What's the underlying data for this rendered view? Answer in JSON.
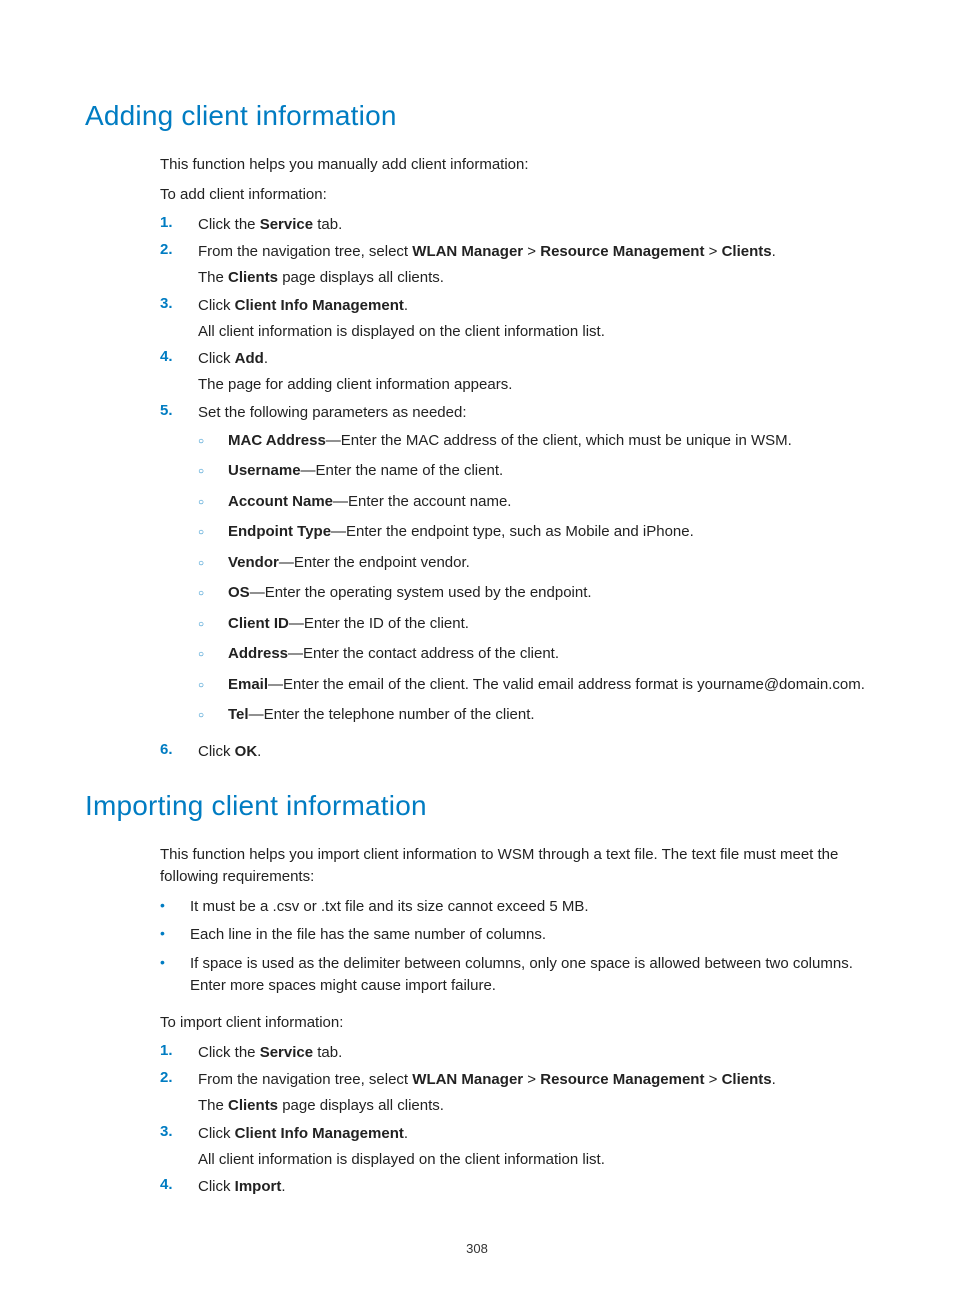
{
  "page_number": "308",
  "section_a": {
    "heading": "Adding client information",
    "intro1": "This function helps you manually add client information:",
    "intro2": "To add client information:",
    "steps": [
      {
        "num": "1.",
        "lines": [
          "Click the <b>Service</b> tab."
        ]
      },
      {
        "num": "2.",
        "lines": [
          "From the navigation tree, select <b>WLAN Manager</b> > <b>Resource Management</b> > <b>Clients</b>.",
          "The <b>Clients</b> page displays all clients."
        ]
      },
      {
        "num": "3.",
        "lines": [
          "Click <b>Client Info Management</b>.",
          "All client information is displayed on the client information list."
        ]
      },
      {
        "num": "4.",
        "lines": [
          "Click <b>Add</b>.",
          "The page for adding client information appears."
        ]
      },
      {
        "num": "5.",
        "lines": [
          "Set the following parameters as needed:"
        ],
        "sub": [
          "<b>MAC Address</b>—Enter the MAC address of the client, which must be unique in WSM.",
          "<b>Username</b>—Enter the name of the client.",
          "<b>Account Name</b>—Enter the account name.",
          "<b>Endpoint Type</b>—Enter the endpoint type, such as Mobile and iPhone.",
          "<b>Vendor</b>—Enter the endpoint vendor.",
          "<b>OS</b>—Enter the operating system used by the endpoint.",
          "<b>Client ID</b>—Enter the ID of the client.",
          "<b>Address</b>—Enter the contact address of the client.",
          "<b>Email</b>—Enter the email of the client. The valid email address format is yourname@domain.com.",
          "<b>Tel</b>—Enter the telephone number of the client."
        ]
      },
      {
        "num": "6.",
        "lines": [
          "Click <b>OK</b>."
        ]
      }
    ]
  },
  "section_b": {
    "heading": "Importing client information",
    "intro": "This function helps you import client information to WSM through a text file. The text file must meet the following requirements:",
    "bullets": [
      "It must be a .csv or .txt file and its size cannot exceed 5 MB.",
      "Each line in the file has the same number of columns.",
      "If space is used as the delimiter between columns, only one space is allowed between two columns. Enter more spaces might cause import failure."
    ],
    "intro2": "To import client information:",
    "steps": [
      {
        "num": "1.",
        "lines": [
          "Click the <b>Service</b> tab."
        ]
      },
      {
        "num": "2.",
        "lines": [
          "From the navigation tree, select <b>WLAN Manager</b> > <b>Resource Management</b> > <b>Clients</b>.",
          "The <b>Clients</b> page displays all clients."
        ]
      },
      {
        "num": "3.",
        "lines": [
          "Click <b>Client Info Management</b>.",
          "All client information is displayed on the client information list."
        ]
      },
      {
        "num": "4.",
        "lines": [
          "Click <b>Import</b>."
        ]
      }
    ]
  }
}
